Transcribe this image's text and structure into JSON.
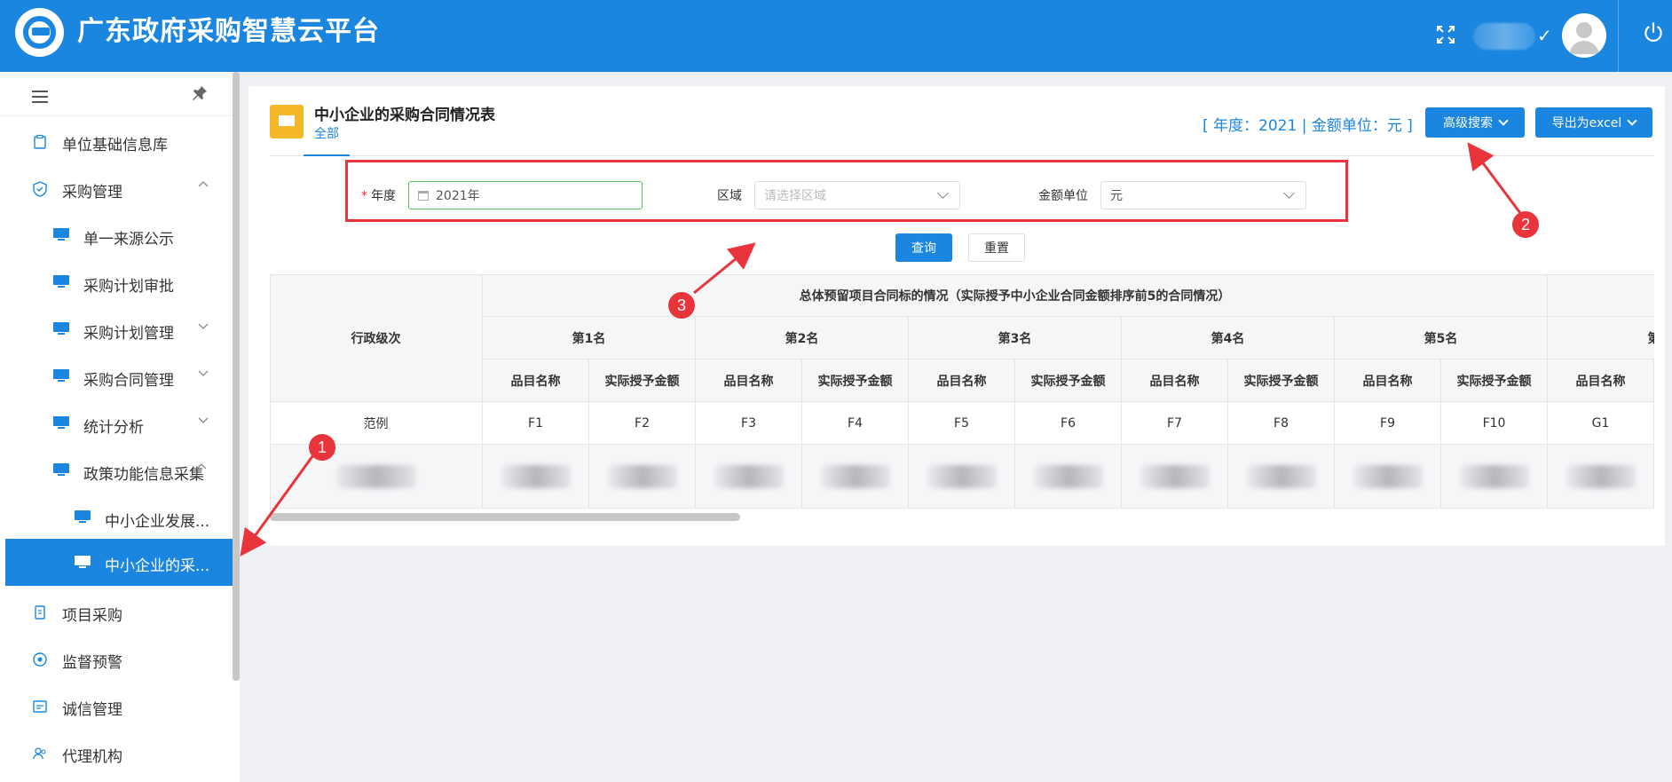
{
  "header": {
    "app_title": "广东政府采购智慧云平台",
    "logo_icon": "ggzy-logo",
    "check_glyph": "✓"
  },
  "sidebar": {
    "items": [
      {
        "label": "单位基础信息库",
        "icon": "clipboard-icon"
      },
      {
        "label": "采购管理",
        "icon": "shield-icon",
        "expanded": true
      },
      {
        "label": "单一来源公示",
        "icon": "monitor-icon"
      },
      {
        "label": "采购计划审批",
        "icon": "monitor-icon"
      },
      {
        "label": "采购计划管理",
        "icon": "monitor-icon"
      },
      {
        "label": "采购合同管理",
        "icon": "monitor-icon"
      },
      {
        "label": "统计分析",
        "icon": "monitor-icon"
      },
      {
        "label": "政策功能信息采集",
        "icon": "monitor-icon",
        "expanded": true
      },
      {
        "label": "中小企业发展...",
        "icon": "monitor-icon"
      },
      {
        "label": "中小企业的采...",
        "icon": "monitor-icon",
        "active": true
      },
      {
        "label": "项目采购",
        "icon": "document-icon"
      },
      {
        "label": "监督预警",
        "icon": "eye-icon"
      },
      {
        "label": "诚信管理",
        "icon": "id-card-icon"
      },
      {
        "label": "代理机构",
        "icon": "user-group-icon"
      }
    ]
  },
  "report": {
    "title": "中小企业的采购合同情况表",
    "tab_all": "全部",
    "meta": "[ 年度：2021 | 金额单位：元 ]",
    "adv_search_label": "高级搜索",
    "export_label": "导出为excel"
  },
  "filters": {
    "year_label": "年度",
    "year_required_mark": "*",
    "year_value": "2021年",
    "region_label": "区域",
    "region_placeholder": "请选择区域",
    "unit_label": "金额单位",
    "unit_value": "元",
    "query_label": "查询",
    "reset_label": "重置"
  },
  "table": {
    "col_admin_level": "行政级次",
    "group_title": "总体预留项目合同标的情况（实际授予中小企业合同金额排序前5的合同情况）",
    "ranks": [
      "第1名",
      "第2名",
      "第3名",
      "第4名",
      "第5名",
      "第"
    ],
    "sub_name": "品目名称",
    "sub_amount": "实际授予金额",
    "example_row": {
      "label": "范例",
      "cells": [
        "F1",
        "F2",
        "F3",
        "F4",
        "F5",
        "F6",
        "F7",
        "F8",
        "F9",
        "F10",
        "G1"
      ]
    }
  },
  "annotations": {
    "badges": [
      "1",
      "2",
      "3"
    ],
    "color": "#e8343a"
  },
  "colors": {
    "brand": "#1a86e0",
    "report_icon": "#f5b829",
    "highlight": "#e8343a"
  }
}
